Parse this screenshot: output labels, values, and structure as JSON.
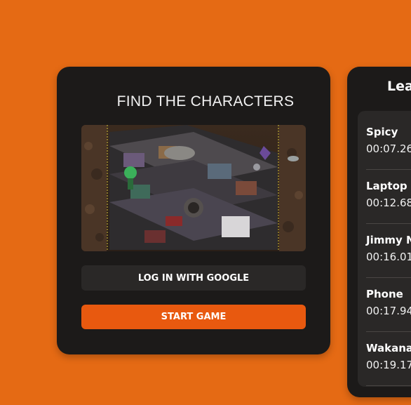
{
  "accent_color": "#e8590f",
  "background_color": "#e56a14",
  "main_card": {
    "title": "FIND THE CHARACTERS",
    "preview_image": "isometric-puzzle-scene",
    "google_button_label": "LOG IN WITH GOOGLE",
    "start_button_label": "START GAME"
  },
  "leaderboard": {
    "title": "Lea",
    "entries": [
      {
        "name": "Spicy",
        "time": "00:07.26"
      },
      {
        "name": "Laptop",
        "time": "00:12.68"
      },
      {
        "name": "Jimmy N",
        "time": "00:16.01"
      },
      {
        "name": "Phone",
        "time": "00:17.94"
      },
      {
        "name": "Wakana",
        "time": "00:19.17"
      }
    ]
  }
}
